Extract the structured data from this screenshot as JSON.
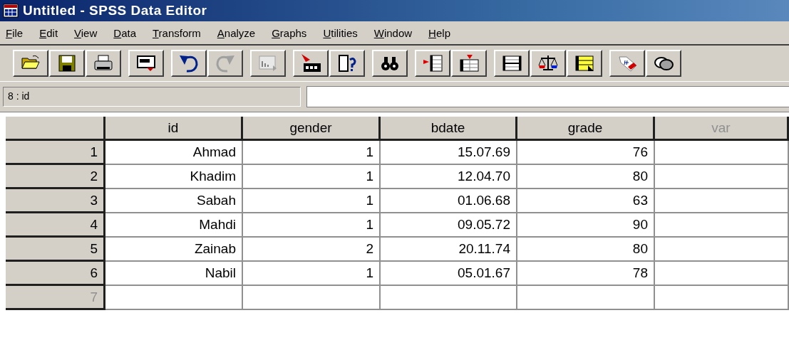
{
  "window": {
    "title": "Untitled - SPSS Data Editor"
  },
  "menu": [
    "File",
    "Edit",
    "View",
    "Data",
    "Transform",
    "Analyze",
    "Graphs",
    "Utilities",
    "Window",
    "Help"
  ],
  "cell_reference": {
    "value": "8 : id"
  },
  "table": {
    "columns": [
      {
        "label": "id",
        "dimmed": false
      },
      {
        "label": "gender",
        "dimmed": false
      },
      {
        "label": "bdate",
        "dimmed": false
      },
      {
        "label": "grade",
        "dimmed": false
      },
      {
        "label": "var",
        "dimmed": true
      }
    ],
    "rows": [
      {
        "number": "1",
        "dimmed": false,
        "cells": [
          "Ahmad",
          "1",
          "15.07.69",
          "76"
        ]
      },
      {
        "number": "2",
        "dimmed": false,
        "cells": [
          "Khadim",
          "1",
          "12.04.70",
          "80"
        ]
      },
      {
        "number": "3",
        "dimmed": false,
        "cells": [
          "Sabah",
          "1",
          "01.06.68",
          "63"
        ]
      },
      {
        "number": "4",
        "dimmed": false,
        "cells": [
          "Mahdi",
          "1",
          "09.05.72",
          "90"
        ]
      },
      {
        "number": "5",
        "dimmed": false,
        "cells": [
          "Zainab",
          "2",
          "20.11.74",
          "80"
        ]
      },
      {
        "number": "6",
        "dimmed": false,
        "cells": [
          "Nabil",
          "1",
          "05.01.67",
          "78"
        ]
      },
      {
        "number": "7",
        "dimmed": true
      }
    ]
  }
}
